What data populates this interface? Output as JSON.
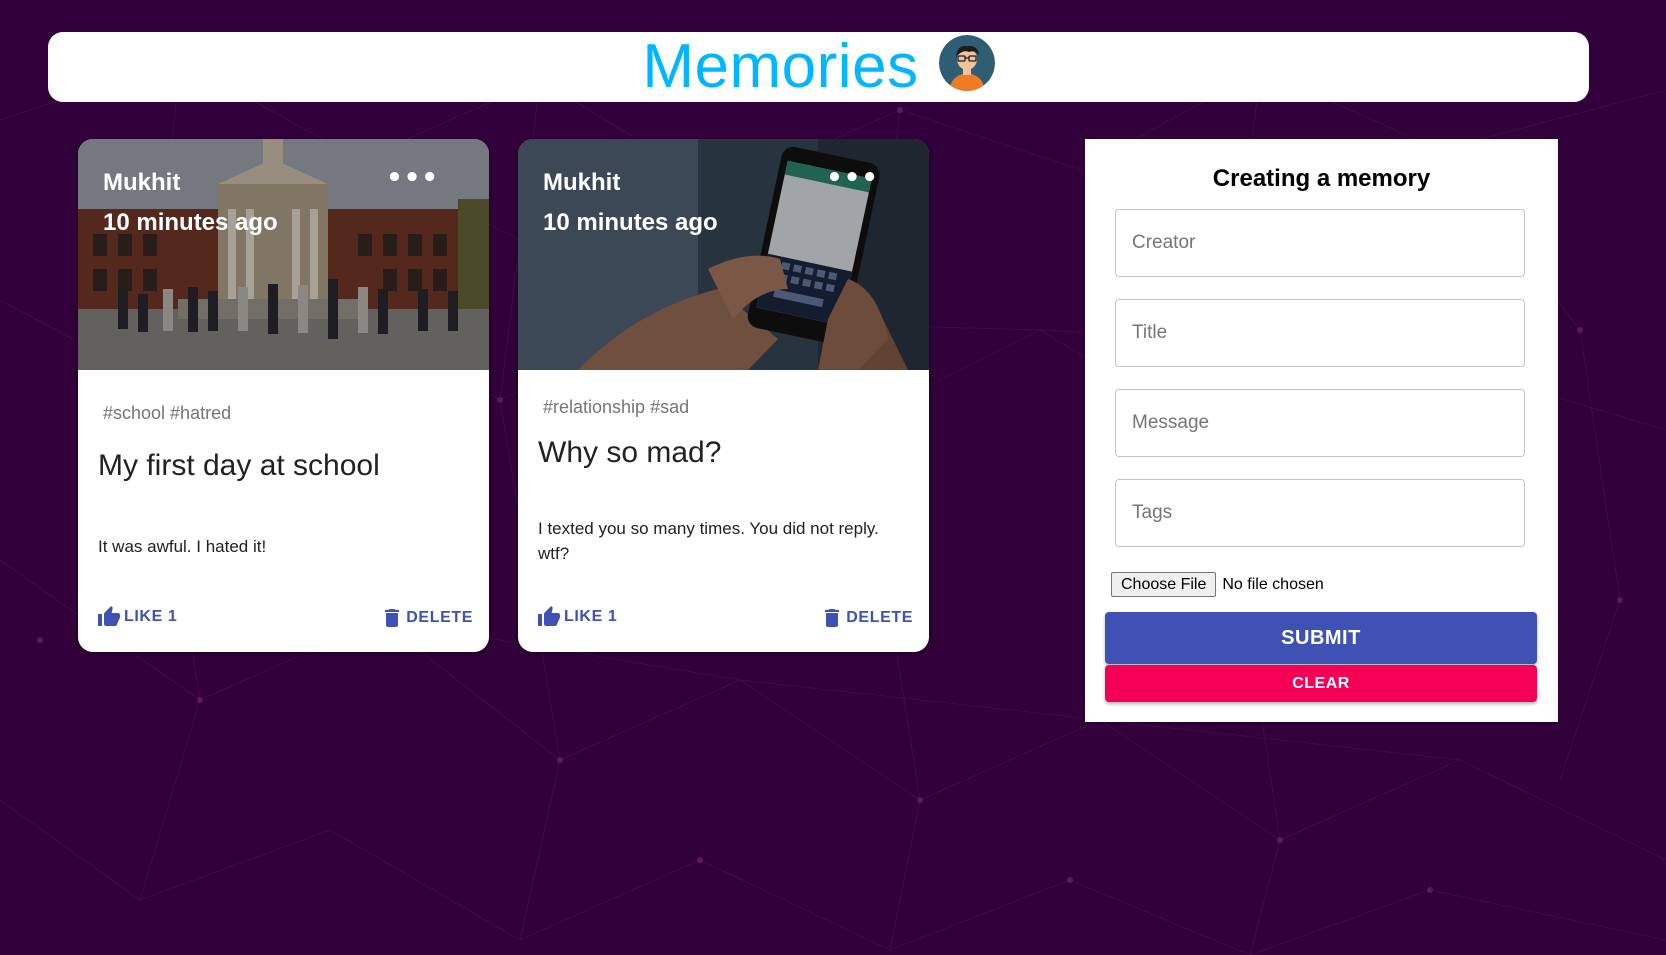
{
  "app": {
    "title": "Memories"
  },
  "colors": {
    "background": "#32003a",
    "title": "#00b7ff",
    "primary": "#3f51b5",
    "secondary": "#f50057"
  },
  "posts": [
    {
      "creator": "Mukhit",
      "time": "10 minutes ago",
      "tags": "#school #hatred",
      "title": "My first day at school",
      "message": "It was awful. I hated it!",
      "like_label": "LIKE 1",
      "delete_label": "DELETE",
      "more_label": "•••",
      "image": "school-building-photo"
    },
    {
      "creator": "Mukhit",
      "time": "10 minutes ago",
      "tags": "#relationship #sad",
      "title": "Why so mad?",
      "message": "I texted you so many times. You did not reply. wtf?",
      "like_label": "LIKE 1",
      "delete_label": "DELETE",
      "more_label": "•••",
      "image": "hands-texting-phone-photo"
    }
  ],
  "form": {
    "heading": "Creating a memory",
    "creator_placeholder": "Creator",
    "title_placeholder": "Title",
    "message_placeholder": "Message",
    "tags_placeholder": "Tags",
    "file_button": "Choose File",
    "file_status": "No file chosen",
    "submit_label": "SUBMIT",
    "clear_label": "CLEAR"
  },
  "icons": {
    "like": "thumb-up-icon",
    "delete": "trash-icon",
    "more": "more-horizontal-icon",
    "avatar": "avatar-icon"
  }
}
